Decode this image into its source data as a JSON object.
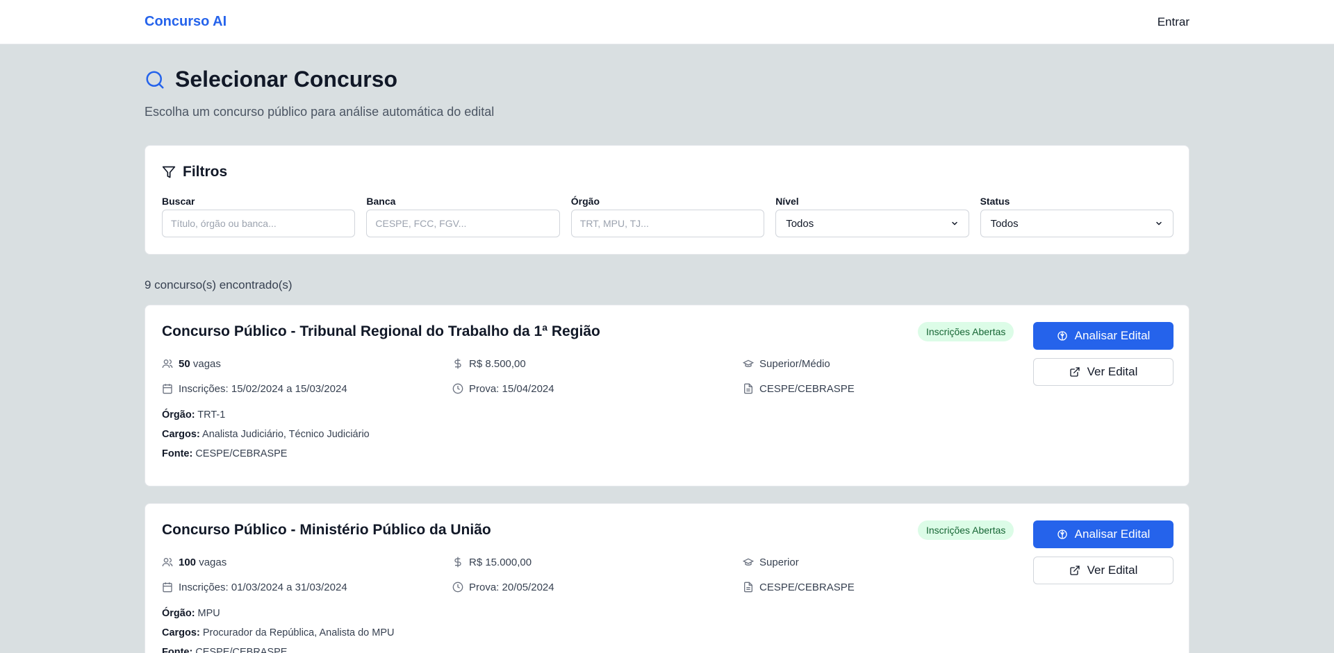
{
  "header": {
    "brand": "Concurso AI",
    "login": "Entrar"
  },
  "page": {
    "title": "Selecionar Concurso",
    "subtitle": "Escolha um concurso público para análise automática do edital"
  },
  "filters": {
    "title": "Filtros",
    "fields": {
      "search": {
        "label": "Buscar",
        "placeholder": "Título, órgão ou banca..."
      },
      "banca": {
        "label": "Banca",
        "placeholder": "CESPE, FCC, FGV..."
      },
      "orgao": {
        "label": "Órgão",
        "placeholder": "TRT, MPU, TJ..."
      },
      "nivel": {
        "label": "Nível",
        "value": "Todos"
      },
      "status": {
        "label": "Status",
        "value": "Todos"
      }
    }
  },
  "results": {
    "count_text": "9 concurso(s) encontrado(s)"
  },
  "contests": [
    {
      "title": "Concurso Público - Tribunal Regional do Trabalho da 1ª Região",
      "status": "Inscrições Abertas",
      "analyze_label": "Analisar Edital",
      "view_label": "Ver Edital",
      "vagas": "50",
      "vagas_suffix": " vagas",
      "salary": "R$ 8.500,00",
      "level": "Superior/Médio",
      "inscricoes": "Inscrições: 15/02/2024 a 15/03/2024",
      "prova": "Prova: 15/04/2024",
      "banca": "CESPE/CEBRASPE",
      "orgao_label": "Órgão:",
      "orgao": " TRT-1",
      "cargos_label": "Cargos:",
      "cargos": " Analista Judiciário, Técnico Judiciário",
      "fonte_label": "Fonte:",
      "fonte": " CESPE/CEBRASPE"
    },
    {
      "title": "Concurso Público - Ministério Público da União",
      "status": "Inscrições Abertas",
      "analyze_label": "Analisar Edital",
      "view_label": "Ver Edital",
      "vagas": "100",
      "vagas_suffix": " vagas",
      "salary": "R$ 15.000,00",
      "level": "Superior",
      "inscricoes": "Inscrições: 01/03/2024 a 31/03/2024",
      "prova": "Prova: 20/05/2024",
      "banca": "CESPE/CEBRASPE",
      "orgao_label": "Órgão:",
      "orgao": " MPU",
      "cargos_label": "Cargos:",
      "cargos": " Procurador da República, Analista do MPU",
      "fonte_label": "Fonte:",
      "fonte": " CESPE/CEBRASPE"
    }
  ],
  "colors": {
    "brand": "#2563eb",
    "badge_bg": "#dcfce7",
    "badge_text": "#166534",
    "background": "#d9dfe1"
  }
}
